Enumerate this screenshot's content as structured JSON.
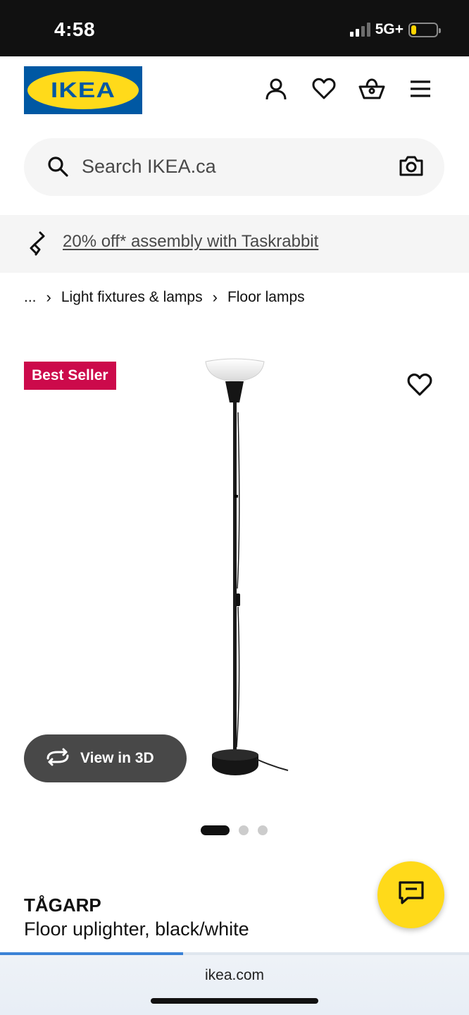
{
  "status_bar": {
    "time": "4:58",
    "network": "5G+",
    "battery_level": 0.2,
    "battery_color": "#ffd400"
  },
  "header": {
    "logo_text": "IKEA",
    "icons": [
      "account-icon",
      "heart-icon",
      "basket-icon",
      "menu-icon"
    ]
  },
  "search": {
    "placeholder": "Search IKEA.ca",
    "icons": [
      "search-icon",
      "camera-icon"
    ]
  },
  "promo": {
    "text": "20% off* assembly with Taskrabbit",
    "icon": "taskrabbit-icon"
  },
  "breadcrumb": {
    "items": [
      "...",
      "Light fixtures & lamps",
      "Floor lamps"
    ]
  },
  "product": {
    "badge": "Best Seller",
    "badge_color": "#cc0a4b",
    "view_3d_label": "View in 3D",
    "image_count": 3,
    "active_image": 1,
    "name": "TÅGARP",
    "description": "Floor uplighter, black/white"
  },
  "chat": {
    "icon": "chat-icon",
    "color": "#ffda1a"
  },
  "browser": {
    "url": "ikea.com",
    "load_progress": 0.39
  },
  "colors": {
    "ikea_blue": "#0058a3",
    "ikea_yellow": "#ffda1a"
  }
}
